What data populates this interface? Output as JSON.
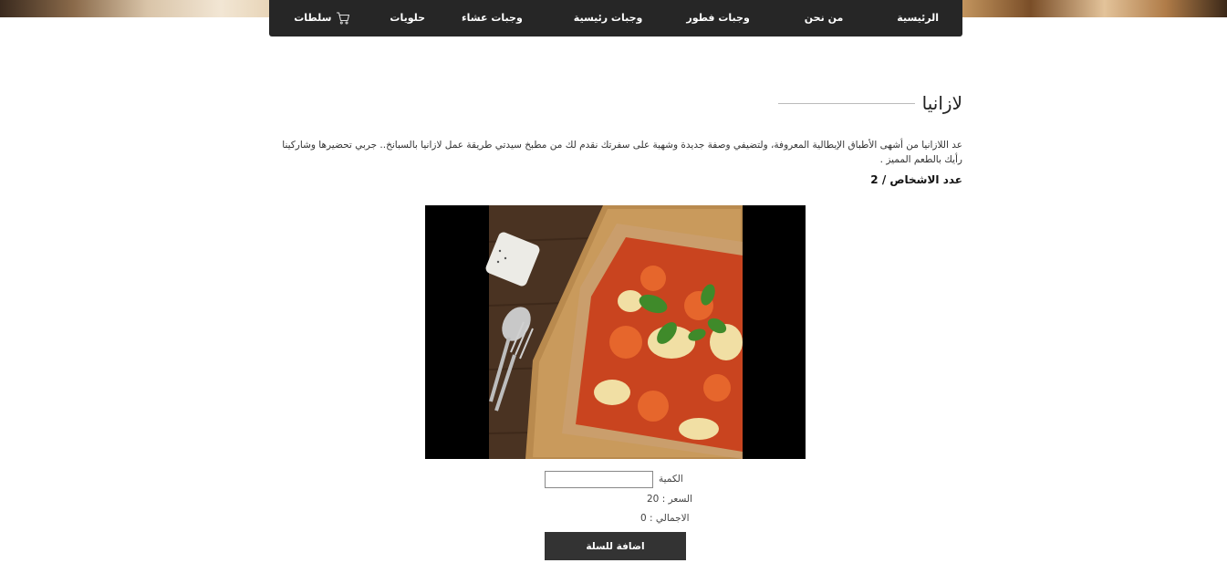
{
  "nav": {
    "items": [
      {
        "label": "الرئيسية"
      },
      {
        "label": "من نحن"
      },
      {
        "label": "وجبات فطور"
      },
      {
        "label": "وجبات رئيسية"
      },
      {
        "label": "وجبات عشاء"
      },
      {
        "label": "حلويات"
      },
      {
        "label": "سلطات"
      }
    ],
    "cart_icon": "cart-icon"
  },
  "recipe": {
    "title": "لازانيا",
    "description": "عد اللازانيا من أشهى الأطباق الإيطالية المعروفة، ولتضيفي وصفة جديدة وشهية على سفرتك نقدم لك من مطبخ سيدتي طريقة عمل لازانيا بالسبانخ.. جربي تحضيرها وشاركينا رأيك بالطعم المميز .",
    "servings": "عدد الاشخاص / 2"
  },
  "order": {
    "quantity_label": "الكمية",
    "quantity_value": "",
    "price_text": "السعر : 20",
    "total_text": "الاجمالي : 0",
    "add_button_label": "اضافة للسلة"
  },
  "colors": {
    "navbar_bg": "#262626",
    "button_bg": "#333333"
  }
}
